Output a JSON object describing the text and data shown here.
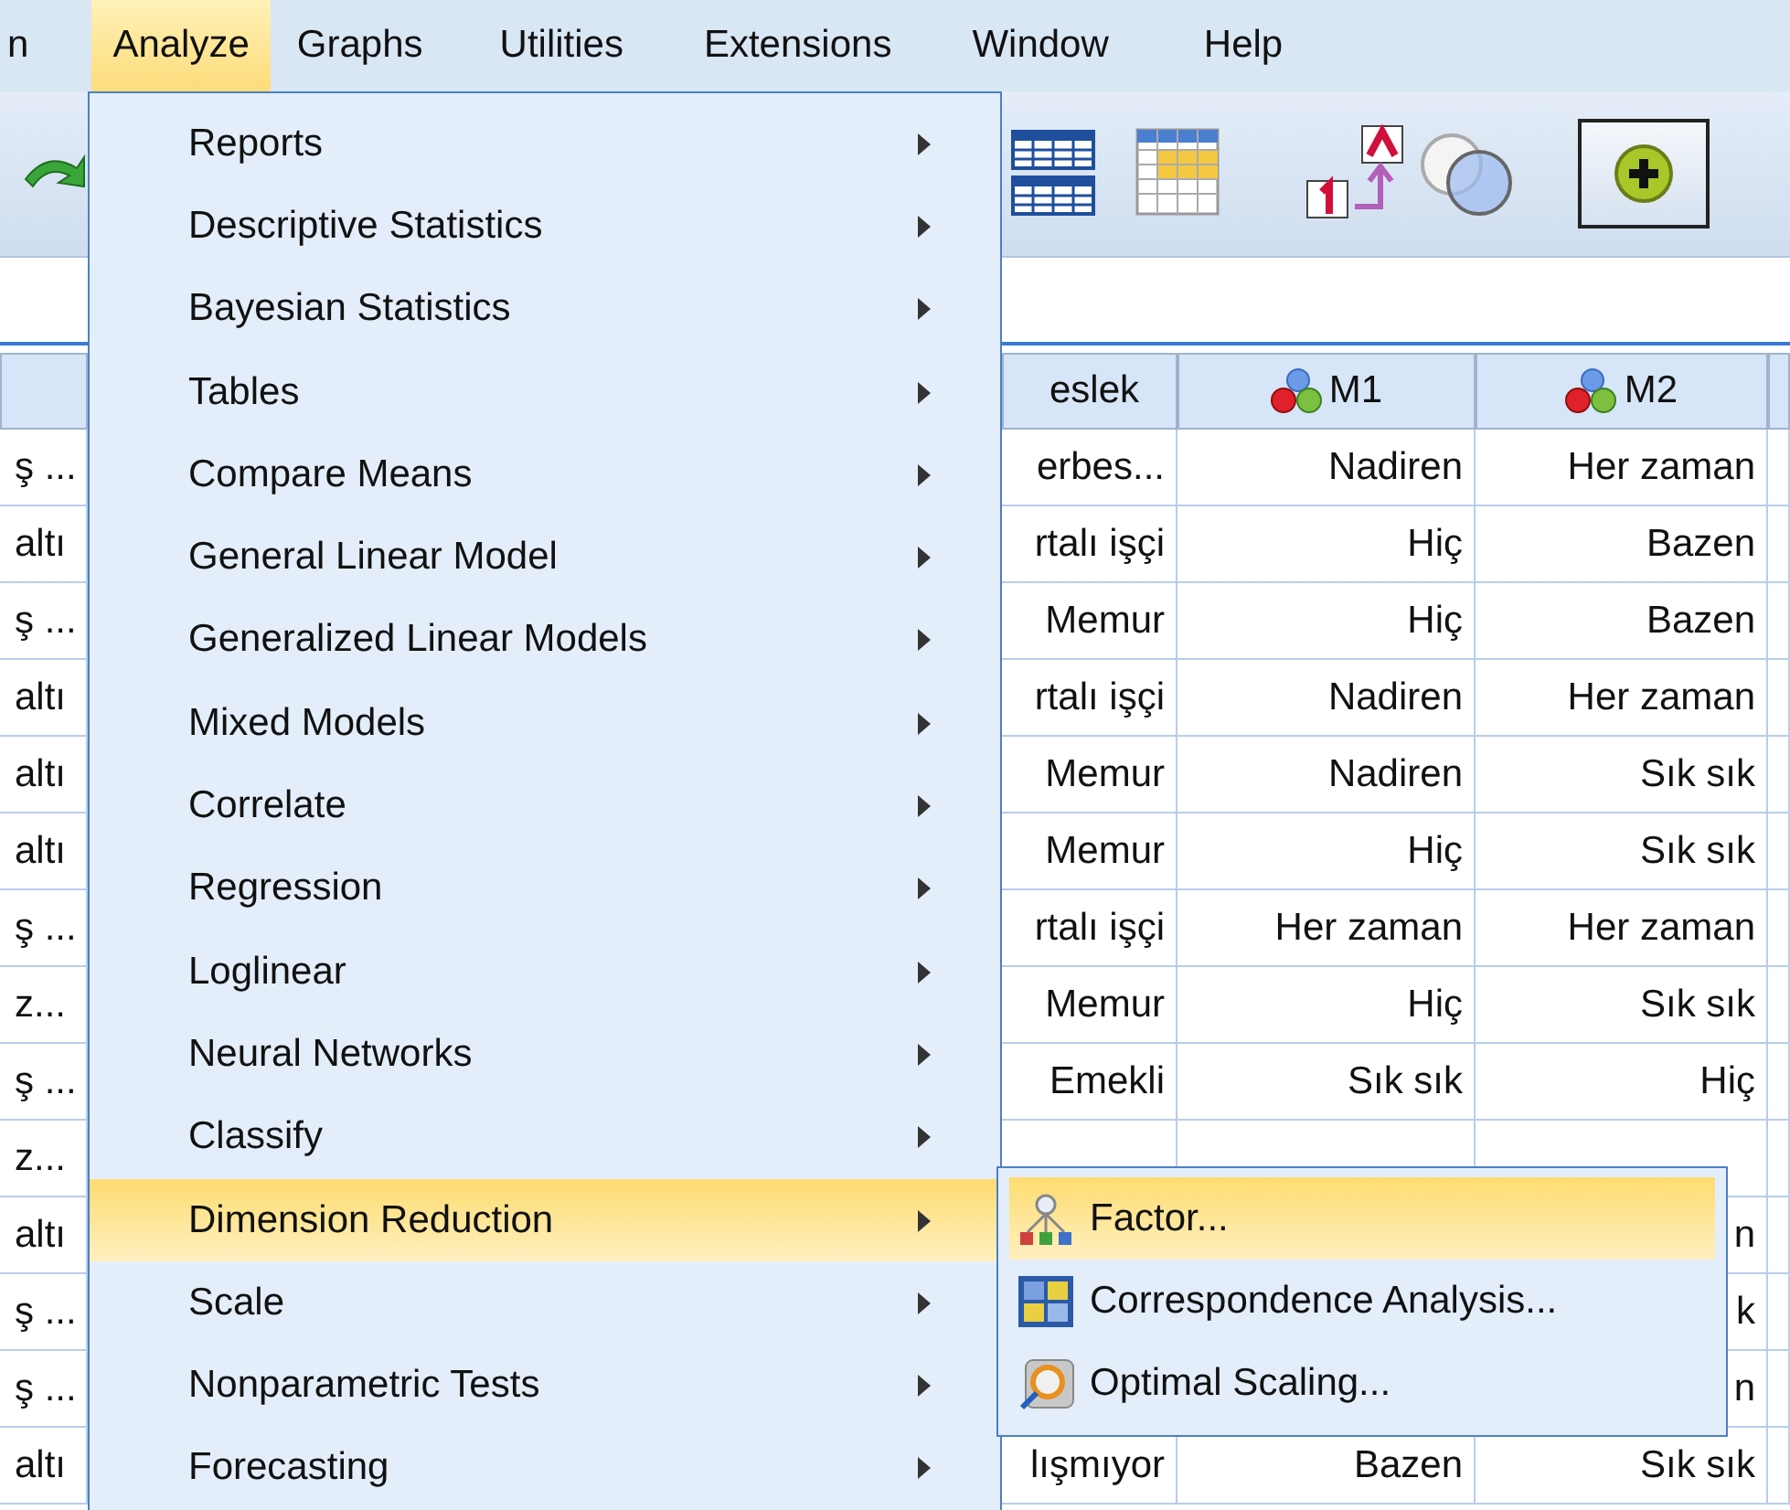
{
  "menubar": [
    {
      "label": "n",
      "selected": false
    },
    {
      "label": "Analyze",
      "selected": true
    },
    {
      "label": "Graphs",
      "selected": false
    },
    {
      "label": "Utilities",
      "selected": false
    },
    {
      "label": "Extensions",
      "selected": false
    },
    {
      "label": "Window",
      "selected": false
    },
    {
      "label": "Help",
      "selected": false
    }
  ],
  "analyze_menu": {
    "items": [
      {
        "label": "Reports",
        "selected": false,
        "submenu": true
      },
      {
        "label": "Descriptive Statistics",
        "selected": false,
        "submenu": true
      },
      {
        "label": "Bayesian Statistics",
        "selected": false,
        "submenu": true
      },
      {
        "label": "Tables",
        "selected": false,
        "submenu": true
      },
      {
        "label": "Compare Means",
        "selected": false,
        "submenu": true
      },
      {
        "label": "General Linear Model",
        "selected": false,
        "submenu": true
      },
      {
        "label": "Generalized Linear Models",
        "selected": false,
        "submenu": true
      },
      {
        "label": "Mixed Models",
        "selected": false,
        "submenu": true
      },
      {
        "label": "Correlate",
        "selected": false,
        "submenu": true
      },
      {
        "label": "Regression",
        "selected": false,
        "submenu": true
      },
      {
        "label": "Loglinear",
        "selected": false,
        "submenu": true
      },
      {
        "label": "Neural Networks",
        "selected": false,
        "submenu": true
      },
      {
        "label": "Classify",
        "selected": false,
        "submenu": true
      },
      {
        "label": "Dimension Reduction",
        "selected": true,
        "submenu": true
      },
      {
        "label": "Scale",
        "selected": false,
        "submenu": true
      },
      {
        "label": "Nonparametric Tests",
        "selected": false,
        "submenu": true
      },
      {
        "label": "Forecasting",
        "selected": false,
        "submenu": true
      }
    ]
  },
  "submenu": {
    "items": [
      {
        "kind": "factor",
        "label": "Factor...",
        "selected": true
      },
      {
        "kind": "correspondence",
        "label": "Correspondence Analysis...",
        "selected": false
      },
      {
        "kind": "scaling",
        "label": "Optimal Scaling...",
        "selected": false
      }
    ]
  },
  "table": {
    "columns": [
      {
        "kind": "string"
      },
      {
        "label": "eslek",
        "kind": "string"
      },
      {
        "label": "M1",
        "kind": "nominal"
      },
      {
        "label": "M2",
        "kind": "nominal"
      }
    ],
    "rows": [
      {
        "cells": [
          "ş ...",
          "erbes...",
          "Nadiren",
          "Her zaman"
        ]
      },
      {
        "cells": [
          "altı",
          "rtalı işçi",
          "Hiç",
          "Bazen"
        ]
      },
      {
        "cells": [
          "ş ...",
          "Memur",
          "Hiç",
          "Bazen"
        ]
      },
      {
        "cells": [
          "altı",
          "rtalı işçi",
          "Nadiren",
          "Her zaman"
        ]
      },
      {
        "cells": [
          "altı",
          "Memur",
          "Nadiren",
          "Sık sık"
        ]
      },
      {
        "cells": [
          "altı",
          "Memur",
          "Hiç",
          "Sık sık"
        ]
      },
      {
        "cells": [
          "ş ...",
          "rtalı işçi",
          "Her zaman",
          "Her zaman"
        ]
      },
      {
        "cells": [
          "z...",
          "Memur",
          "Hiç",
          "Sık sık"
        ]
      },
      {
        "cells": [
          "ş ...",
          "Emekli",
          "Sık sık",
          "Hiç"
        ]
      },
      {
        "cells": [
          "z...",
          null,
          null,
          null
        ]
      },
      {
        "cells": [
          "altı",
          null,
          null,
          "n"
        ]
      },
      {
        "cells": [
          "ş ...",
          null,
          null,
          "k"
        ]
      },
      {
        "cells": [
          "ş ...",
          null,
          null,
          "n"
        ]
      },
      {
        "cells": [
          "altı",
          "lışmıyor",
          "Bazen",
          "Sık sık"
        ]
      }
    ]
  }
}
